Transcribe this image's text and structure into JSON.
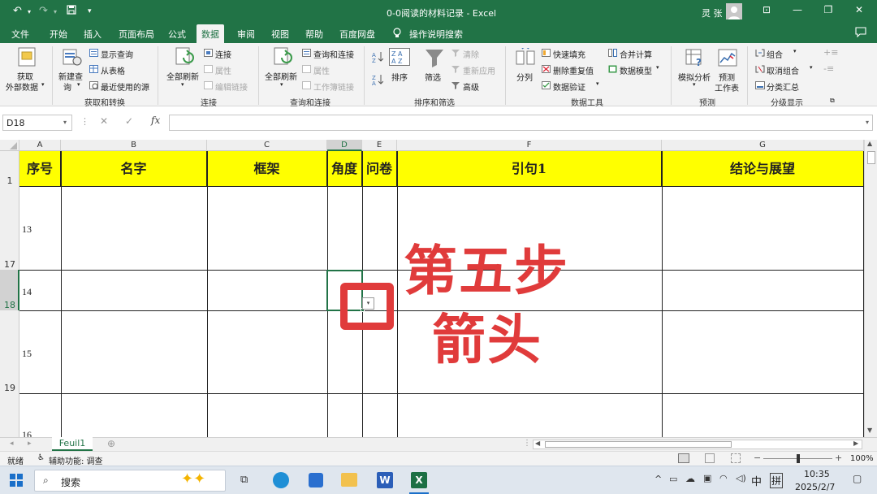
{
  "window": {
    "title": "0-0阅读的材料记录  -  Excel",
    "user_name": "灵 张"
  },
  "tabs": [
    "文件",
    "开始",
    "插入",
    "页面布局",
    "公式",
    "数据",
    "审阅",
    "视图",
    "帮助",
    "百度网盘"
  ],
  "active_tab": "数据",
  "tell_me": "操作说明搜索",
  "ribbon": {
    "get_data": [
      "获取",
      "外部数据"
    ],
    "new_query": [
      "新建查",
      "询"
    ],
    "show_query": "显示查询",
    "from_table": "从表格",
    "recent_sources": "最近使用的源",
    "group_get_transform": "获取和转换",
    "refresh_all": "全部刷新",
    "connections": "连接",
    "properties": "属性",
    "edit_links": "编辑链接",
    "group_connections": "连接",
    "refresh_all2": "全部刷新",
    "queries_connections": "查询和连接",
    "properties2": "属性",
    "workbook_links": "工作簿链接",
    "group_queries": "查询和连接",
    "sort": "排序",
    "filter": "筛选",
    "clear": "清除",
    "reapply": "重新应用",
    "advanced": "高级",
    "group_sort_filter": "排序和筛选",
    "text_to_columns": "分列",
    "flash_fill": "快速填充",
    "remove_duplicates": "删除重复值",
    "data_validation": "数据验证",
    "consolidate": "合并计算",
    "data_model": "数据模型",
    "group_data_tools": "数据工具",
    "what_if": "模拟分析",
    "forecast_sheet": [
      "预测",
      "工作表"
    ],
    "group_forecast": "预测",
    "group": "组合",
    "ungroup": "取消组合",
    "subtotal": "分类汇总",
    "group_outline": "分级显示"
  },
  "formula_bar": {
    "name_box": "D18",
    "fx": "fx",
    "formula": ""
  },
  "columns": [
    "A",
    "B",
    "C",
    "D",
    "E",
    "F",
    "G"
  ],
  "header_row": {
    "row_number": "1",
    "cells": [
      "序号",
      "名字",
      "框架",
      "角度",
      "问卷",
      "引句1",
      "结论与展望"
    ]
  },
  "rows": [
    {
      "row_number": "17",
      "seq": "13"
    },
    {
      "row_number": "18",
      "seq": "14"
    },
    {
      "row_number": "19",
      "seq": "15"
    },
    {
      "row_number": "",
      "seq": "16"
    }
  ],
  "overlay": {
    "line1": "第五步",
    "line2": "箭头"
  },
  "sheet_tab": "Feuil1",
  "status": {
    "ready": "就绪",
    "accessibility": "辅助功能: 调查",
    "zoom": "100%"
  },
  "taskbar": {
    "search": "搜索",
    "ime": "中",
    "ime2": "拼",
    "time": "10:35",
    "date": "2025/2/7"
  },
  "colors": {
    "excel_green": "#217346",
    "header_fill": "#ffff00",
    "overlay_red": "#e03b3b"
  }
}
